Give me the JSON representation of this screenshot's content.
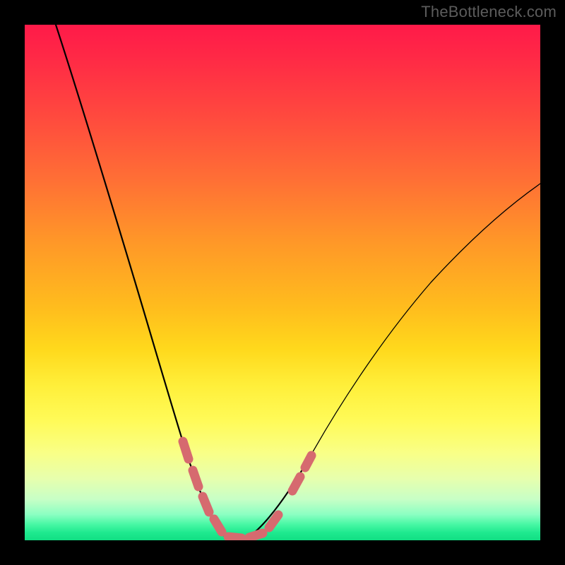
{
  "watermark": {
    "text": "TheBottleneck.com"
  },
  "colors": {
    "background": "#000000",
    "gradient_top": "#ff1a49",
    "gradient_mid": "#ffd91c",
    "gradient_bottom": "#11df84",
    "curve": "#000000",
    "dash": "#d66a6f",
    "watermark": "#5c5c5c"
  },
  "chart_data": {
    "type": "line",
    "title": "",
    "xlabel": "",
    "ylabel": "",
    "xlim": [
      0,
      100
    ],
    "ylim": [
      0,
      100
    ],
    "grid": false,
    "legend": false,
    "series": [
      {
        "name": "bottleneck-curve",
        "x": [
          6,
          10,
          14,
          18,
          22,
          26,
          30,
          32,
          34,
          36,
          38,
          40,
          44,
          48,
          52,
          56,
          60,
          66,
          72,
          78,
          84,
          90,
          95,
          100
        ],
        "y": [
          100,
          88,
          76,
          64,
          52,
          40,
          27,
          20,
          13,
          7,
          3,
          1,
          1,
          4,
          9,
          16,
          23,
          33,
          42,
          50,
          57,
          63,
          67,
          70
        ]
      }
    ],
    "highlighted_region": {
      "name": "dashed-valley",
      "x": [
        30,
        32,
        34,
        36,
        38,
        40,
        42,
        44,
        46,
        48
      ],
      "y": [
        27,
        20,
        13,
        7,
        3,
        1,
        1,
        2,
        5,
        9
      ]
    },
    "notes": "V-shaped bottleneck curve with minimum near x≈38–42%. Left branch descends steeply from top-left; right branch rises more gently toward ~70% at the right edge. Dashed salmon segments highlight the valley region. Values estimated from pixel positions; chart has no visible tick labels."
  }
}
